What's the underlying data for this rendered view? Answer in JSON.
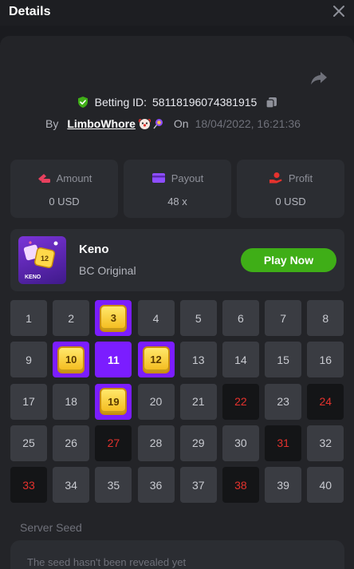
{
  "header": {
    "title": "Details"
  },
  "bet": {
    "id_label": "Betting ID:",
    "id_value": "58118196074381915",
    "by_label": "By",
    "username": "LimboWhore",
    "on_label": "On",
    "date": "18/04/2022, 16:21:36"
  },
  "stats": [
    {
      "label": "Amount",
      "value": "0 USD",
      "icon": "coins-icon",
      "color": "#e8405e"
    },
    {
      "label": "Payout",
      "value": "48 x",
      "icon": "wallet-icon",
      "color": "#8d4dff"
    },
    {
      "label": "Profit",
      "value": "0 USD",
      "icon": "hand-coin-icon",
      "color": "#e5322d"
    }
  ],
  "game": {
    "name": "Keno",
    "subtitle": "BC Original",
    "play_label": "Play Now",
    "thumb_text": "KENO",
    "thumb_tile": "12"
  },
  "grid": {
    "numbers": [
      1,
      2,
      3,
      4,
      5,
      6,
      7,
      8,
      9,
      10,
      11,
      12,
      13,
      14,
      15,
      16,
      17,
      18,
      19,
      20,
      21,
      22,
      23,
      24,
      25,
      26,
      27,
      28,
      29,
      30,
      31,
      32,
      33,
      34,
      35,
      36,
      37,
      38,
      39,
      40
    ],
    "hits": [
      3,
      10,
      12,
      19
    ],
    "selected": [
      11
    ],
    "misses": [
      22,
      24,
      27,
      31,
      33,
      38
    ]
  },
  "seed": {
    "label": "Server Seed",
    "text": "The seed hasn't been revealed yet"
  },
  "colors": {
    "accent": "#7b1dff",
    "play": "#3fae17",
    "miss_text": "#e5322d",
    "verified": "#3fae17"
  }
}
